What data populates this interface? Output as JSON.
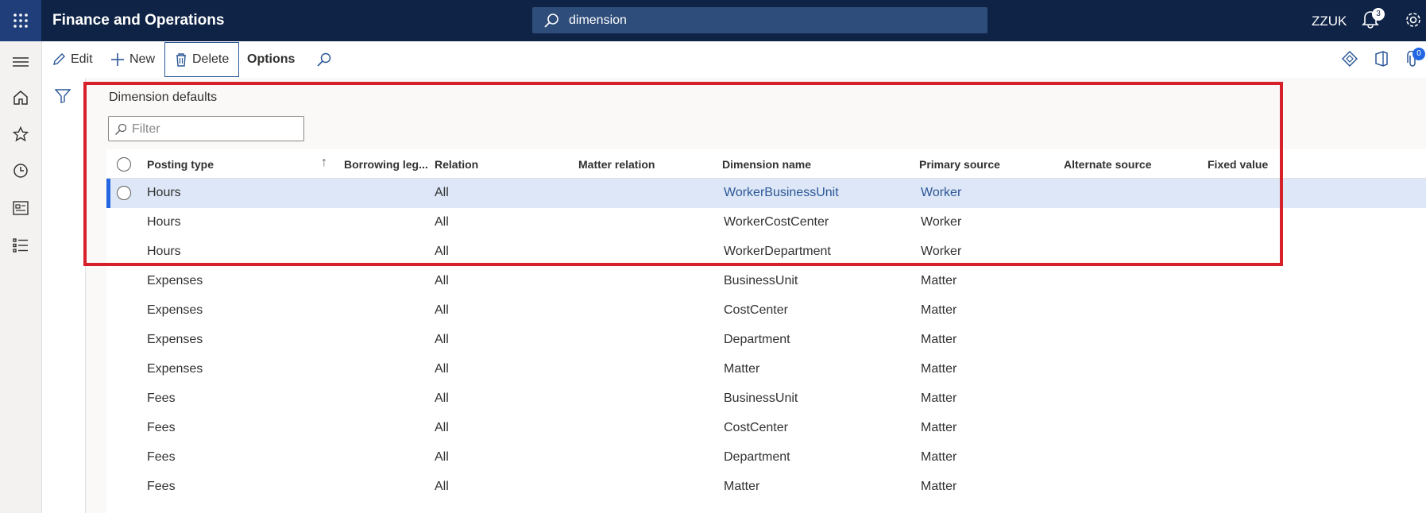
{
  "header": {
    "app_title": "Finance and Operations",
    "search_value": "dimension",
    "company": "ZZUK",
    "notification_count": "3"
  },
  "actions": {
    "edit": "Edit",
    "new": "New",
    "delete": "Delete",
    "options": "Options",
    "attachments_count": "0"
  },
  "section": {
    "title": "Dimension defaults",
    "filter_placeholder": "Filter"
  },
  "grid": {
    "columns": [
      "Posting type",
      "Borrowing leg...",
      "Relation",
      "Matter relation",
      "Dimension name",
      "Primary source",
      "Alternate source",
      "Fixed value"
    ],
    "sort_indicator": "↑",
    "rows": [
      {
        "posting_type": "Hours",
        "borrowing": "",
        "relation": "All",
        "matter_relation": "",
        "dimension": "WorkerBusinessUnit",
        "primary": "Worker",
        "alternate": "",
        "fixed": ""
      },
      {
        "posting_type": "Hours",
        "borrowing": "",
        "relation": "All",
        "matter_relation": "",
        "dimension": "WorkerCostCenter",
        "primary": "Worker",
        "alternate": "",
        "fixed": ""
      },
      {
        "posting_type": "Hours",
        "borrowing": "",
        "relation": "All",
        "matter_relation": "",
        "dimension": "WorkerDepartment",
        "primary": "Worker",
        "alternate": "",
        "fixed": ""
      },
      {
        "posting_type": "Expenses",
        "borrowing": "",
        "relation": "All",
        "matter_relation": "",
        "dimension": "BusinessUnit",
        "primary": "Matter",
        "alternate": "",
        "fixed": ""
      },
      {
        "posting_type": "Expenses",
        "borrowing": "",
        "relation": "All",
        "matter_relation": "",
        "dimension": "CostCenter",
        "primary": "Matter",
        "alternate": "",
        "fixed": ""
      },
      {
        "posting_type": "Expenses",
        "borrowing": "",
        "relation": "All",
        "matter_relation": "",
        "dimension": "Department",
        "primary": "Matter",
        "alternate": "",
        "fixed": ""
      },
      {
        "posting_type": "Expenses",
        "borrowing": "",
        "relation": "All",
        "matter_relation": "",
        "dimension": "Matter",
        "primary": "Matter",
        "alternate": "",
        "fixed": ""
      },
      {
        "posting_type": "Fees",
        "borrowing": "",
        "relation": "All",
        "matter_relation": "",
        "dimension": "BusinessUnit",
        "primary": "Matter",
        "alternate": "",
        "fixed": ""
      },
      {
        "posting_type": "Fees",
        "borrowing": "",
        "relation": "All",
        "matter_relation": "",
        "dimension": "CostCenter",
        "primary": "Matter",
        "alternate": "",
        "fixed": ""
      },
      {
        "posting_type": "Fees",
        "borrowing": "",
        "relation": "All",
        "matter_relation": "",
        "dimension": "Department",
        "primary": "Matter",
        "alternate": "",
        "fixed": ""
      },
      {
        "posting_type": "Fees",
        "borrowing": "",
        "relation": "All",
        "matter_relation": "",
        "dimension": "Matter",
        "primary": "Matter",
        "alternate": "",
        "fixed": ""
      }
    ]
  },
  "colors": {
    "nav_bar": "#0f2346",
    "selection": "#dde7f7",
    "highlight_box": "#d6202a"
  }
}
